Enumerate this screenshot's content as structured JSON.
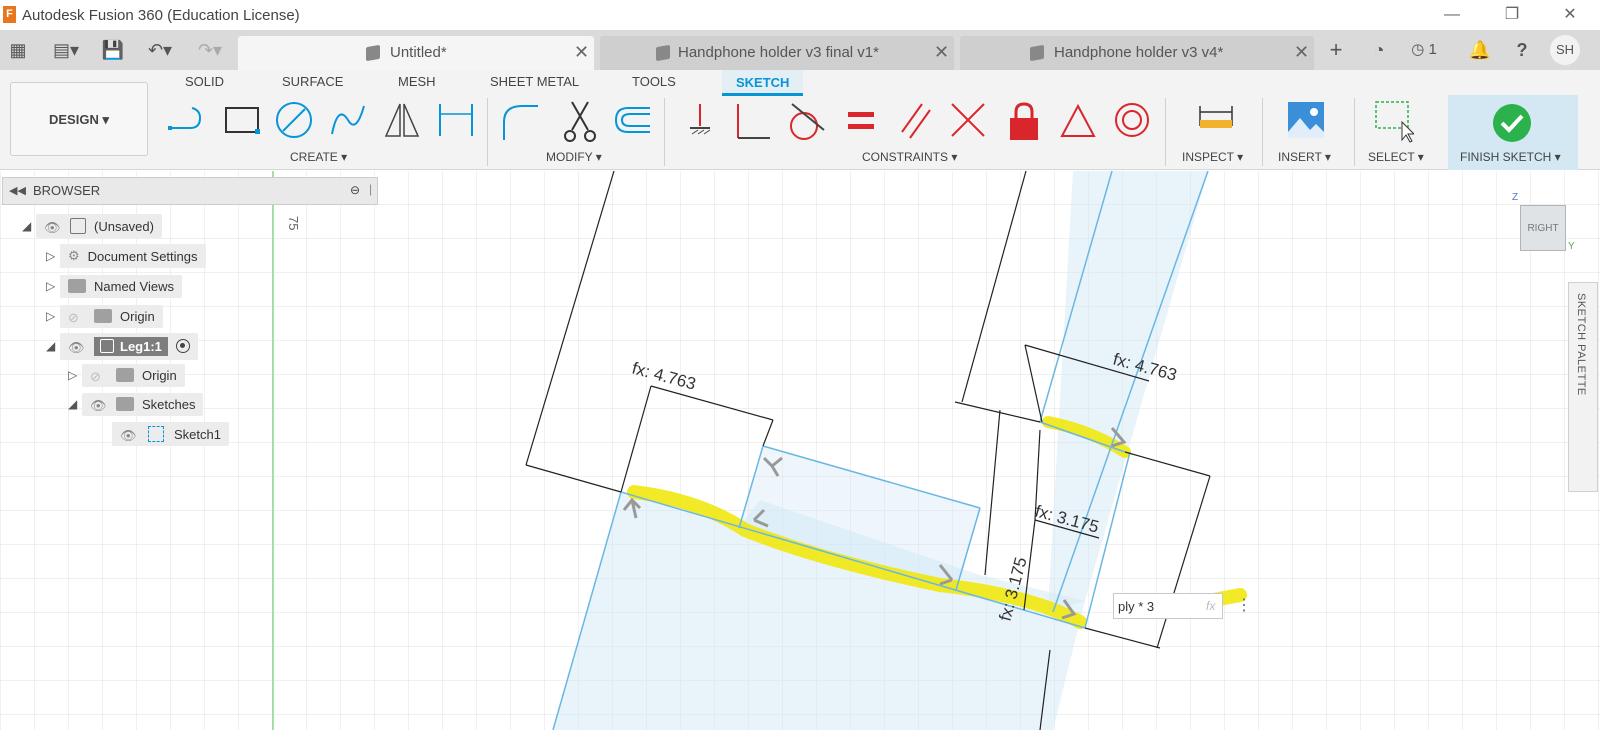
{
  "app": {
    "title": "Autodesk Fusion 360 (Education License)",
    "logo": "F",
    "minimize": "—",
    "restore": "❐",
    "close": "✕"
  },
  "tabbar": {
    "tabs": [
      {
        "label": "Untitled*",
        "close": "✕"
      },
      {
        "label": "Handphone holder v3 final v1*",
        "close": "✕"
      },
      {
        "label": "Handphone holder v3 v4*",
        "close": "✕"
      }
    ],
    "new_tab": "+",
    "job_count": "1",
    "user_initials": "SH"
  },
  "ribbon": {
    "workspace": "DESIGN ▾",
    "tabs": [
      "SOLID",
      "SURFACE",
      "MESH",
      "SHEET METAL",
      "TOOLS",
      "SKETCH"
    ],
    "groups": {
      "create": "CREATE ▾",
      "modify": "MODIFY ▾",
      "constraints": "CONSTRAINTS ▾",
      "inspect": "INSPECT ▾",
      "insert": "INSERT ▾",
      "select": "SELECT ▾",
      "finish": "FINISH SKETCH ▾"
    }
  },
  "browser": {
    "title": "BROWSER",
    "items": [
      {
        "label": "(Unsaved)"
      },
      {
        "label": "Document Settings"
      },
      {
        "label": "Named Views"
      },
      {
        "label": "Origin"
      },
      {
        "label": "Leg1:1"
      },
      {
        "label": "Origin"
      },
      {
        "label": "Sketches"
      },
      {
        "label": "Sketch1"
      }
    ]
  },
  "canvas": {
    "ruler_label": "75",
    "dimensions": [
      "fx: 4.763",
      "fx: 4.763",
      "fx: 3.175",
      "fx: 3.175"
    ],
    "dim_input_value": "ply * 3",
    "dim_input_fx": "fx",
    "viewcube_face": "RIGHT",
    "viewcube_axis_z": "Z",
    "viewcube_axis_y": "Y"
  },
  "palette": {
    "label": "SKETCH PALETTE"
  },
  "colors": {
    "accent": "#0696d7",
    "highlight": "#f0e600",
    "sketch_line": "#6ab7e3",
    "finish_green": "#2bb24c"
  }
}
